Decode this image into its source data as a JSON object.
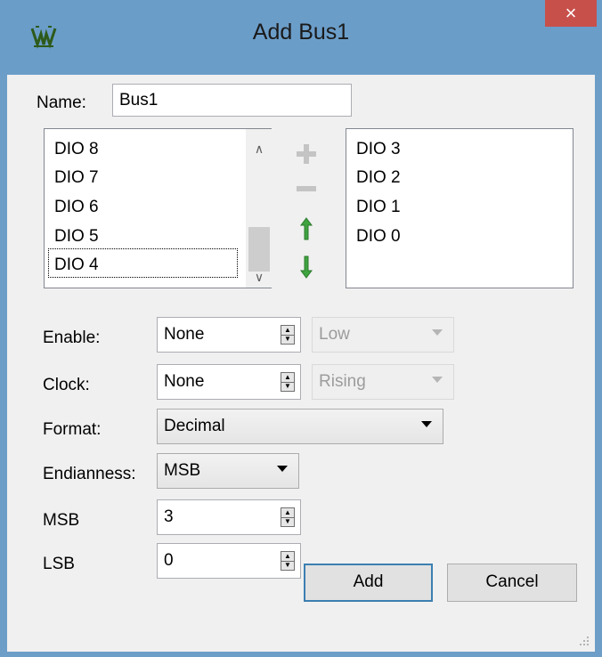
{
  "window": {
    "title": "Add Bus1",
    "close_glyph": "×",
    "icon": "app-logo-icon"
  },
  "name_field": {
    "label": "Name:",
    "value": "Bus1"
  },
  "available_list": {
    "items": [
      "DIO 8",
      "DIO 7",
      "DIO 6",
      "DIO 5",
      "DIO 4"
    ],
    "focused": "DIO 4"
  },
  "selected_list": {
    "items": [
      "DIO 3",
      "DIO 2",
      "DIO 1",
      "DIO 0"
    ]
  },
  "tools": {
    "add": "plus-icon",
    "remove": "minus-icon",
    "up": "arrow-up-icon",
    "down": "arrow-down-icon"
  },
  "enable": {
    "label": "Enable:",
    "value": "None",
    "level": "Low"
  },
  "clock": {
    "label": "Clock:",
    "value": "None",
    "edge": "Rising"
  },
  "format": {
    "label": "Format:",
    "value": "Decimal"
  },
  "endianness": {
    "label": "Endianness:",
    "value": "MSB"
  },
  "msb": {
    "label": "MSB",
    "value": "3"
  },
  "lsb": {
    "label": "LSB",
    "value": "0"
  },
  "buttons": {
    "add": "Add",
    "cancel": "Cancel"
  },
  "colors": {
    "titlebar": "#6b9dc9",
    "close": "#c7504b",
    "green_arrow": "#3fa33f",
    "client": "#f0f0f0"
  }
}
